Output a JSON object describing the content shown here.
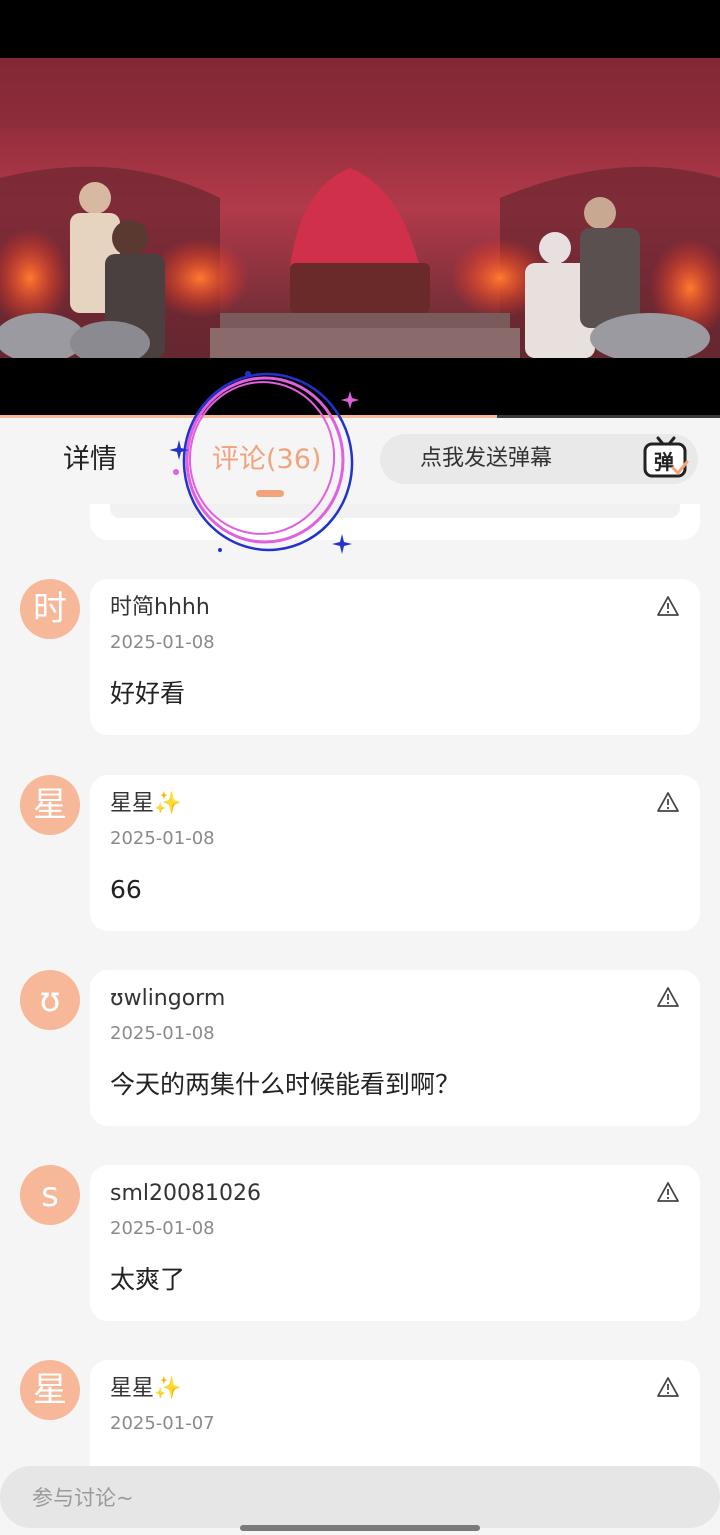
{
  "colors": {
    "accent": "#f2a37d",
    "avatar_bg": "#f6b898",
    "annotation_blue": "#2233cc",
    "annotation_pink": "#e060e0"
  },
  "video": {
    "progress_fraction": 0.69
  },
  "tabs": [
    {
      "label": "详情"
    },
    {
      "label": "评论(36)"
    }
  ],
  "danmaku": {
    "placeholder": "点我发送弹幕",
    "icon_char": "弹"
  },
  "comments": [
    {
      "avatar": "时",
      "user": "时简hhhh",
      "date": "2025-01-08",
      "text": "好好看"
    },
    {
      "avatar": "星",
      "user": "星星✨",
      "date": "2025-01-08",
      "text": "66"
    },
    {
      "avatar": "ʊ",
      "user": "ʊwlingorm",
      "date": "2025-01-08",
      "text": "今天的两集什么时候能看到啊？"
    },
    {
      "avatar": "s",
      "user": "sml20081026",
      "date": "2025-01-08",
      "text": "太爽了"
    },
    {
      "avatar": "星",
      "user": "星星✨",
      "date": "2025-01-07",
      "text": ""
    }
  ],
  "input": {
    "placeholder": "参与讨论~"
  },
  "icons": {
    "report": "warning-triangle-icon",
    "danmaku": "danmaku-tv-icon"
  }
}
